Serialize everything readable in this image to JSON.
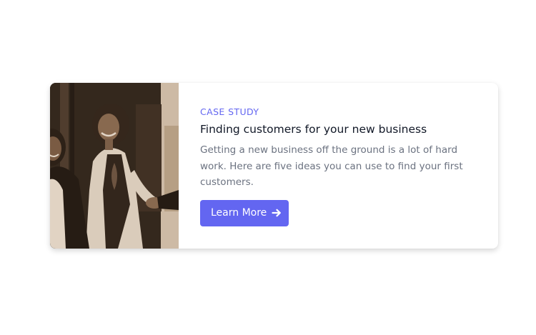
{
  "card": {
    "eyebrow": "CASE STUDY",
    "title": "Finding customers for your new business",
    "description": "Getting a new business off the ground is a lot of hard work. Here are five ideas you can use to find your first customers.",
    "button_label": "Learn More",
    "button_icon": "arrow-right-icon",
    "image_alt": "Business people shaking hands"
  },
  "colors": {
    "accent": "#6366f1",
    "title": "#111827",
    "body": "#6b7280"
  }
}
